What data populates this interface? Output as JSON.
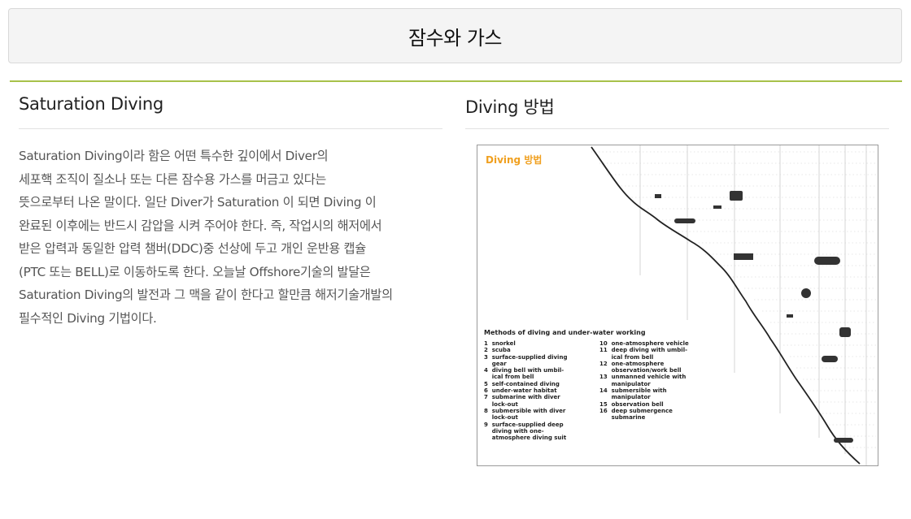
{
  "header": {
    "title": "잠수와 가스"
  },
  "left": {
    "title": "Saturation Diving",
    "paragraph_lines": [
      "  Saturation Diving이라 함은 어떤 특수한 깊이에서 Diver의",
      "세포핵 조직이 질소나 또는 다른 잠수용 가스를 머금고 있다는",
      "뜻으로부터 나온 말이다. 일단 Diver가 Saturation 이 되면 Diving 이",
      "완료된 이후에는 반드시 감압을 시켜 주어야 한다. 즉, 작업시의 해저에서",
      "받은 압력과 동일한 압력 챔버(DDC)중 선상에 두고 개인 운반용 캡슐",
      "(PTC 또는 BELL)로 이동하도록 한다. 오늘날 Offshore기술의 발달은",
      "Saturation Diving의 발전과 그 맥을 같이 한다고 할만큼 해저기술개발의",
      "필수적인 Diving 기법이다."
    ]
  },
  "right": {
    "title": "Diving 방법",
    "figure": {
      "title": "Diving 방법",
      "legend_title": "Methods of diving and under-water working",
      "legend_left": [
        "1  snorkel",
        "2  scuba",
        "3  surface-supplied diving",
        "    gear",
        "4  diving bell with umbil-",
        "    ical from bell",
        "5  self-contained diving",
        "6  under-water habitat",
        "7  submarine with diver",
        "    lock-out",
        "8  submersible with diver",
        "    lock-out",
        "9  surface-supplied deep",
        "    diving with one-",
        "    atmosphere diving suit"
      ],
      "legend_right": [
        "10  one-atmosphere vehicle",
        "11  deep diving with umbil-",
        "      ical from bell",
        "12  one-atmosphere",
        "      observation/work bell",
        "13  unmanned vehicle with",
        "      manipulator",
        "14  submersible with",
        "      manipulator",
        "15  observation bell",
        "16  deep submergence",
        "      submarine"
      ]
    }
  },
  "colors": {
    "accent_rule": "#a7c14a",
    "figure_title": "#f0a020"
  }
}
